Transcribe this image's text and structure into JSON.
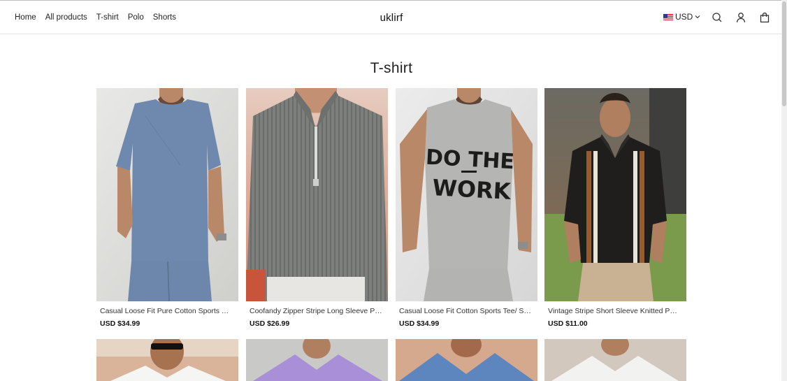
{
  "header": {
    "nav": [
      "Home",
      "All products",
      "T-shirt",
      "Polo",
      "Shorts"
    ],
    "brand": "uklirf",
    "currency": "USD"
  },
  "page": {
    "title": "T-shirt"
  },
  "products": [
    {
      "name": "Casual Loose Fit Pure Cotton Sports T-shirt",
      "price": "USD $34.99",
      "image": "blue-tshirt-set"
    },
    {
      "name": "Coofandy Zipper Stripe Long Sleeve Polo",
      "price": "USD $26.99",
      "image": "grey-zip-polo"
    },
    {
      "name": "Casual Loose Fit Cotton Sports Tee/ Sports",
      "price": "USD $34.99",
      "image": "do-the-work-tee",
      "print_text": [
        "DO THE",
        "WORK"
      ]
    },
    {
      "name": "Vintage Stripe Short Sleeve Knitted Polo Shirt",
      "price": "USD $11.00",
      "image": "stripe-knit-polo"
    }
  ],
  "row2_images": [
    "white-shirt-sunglasses",
    "purple-henley",
    "blue-vneck",
    "white-henley"
  ],
  "colors": {
    "accent": "#222222",
    "border": "#e4e4e4"
  }
}
